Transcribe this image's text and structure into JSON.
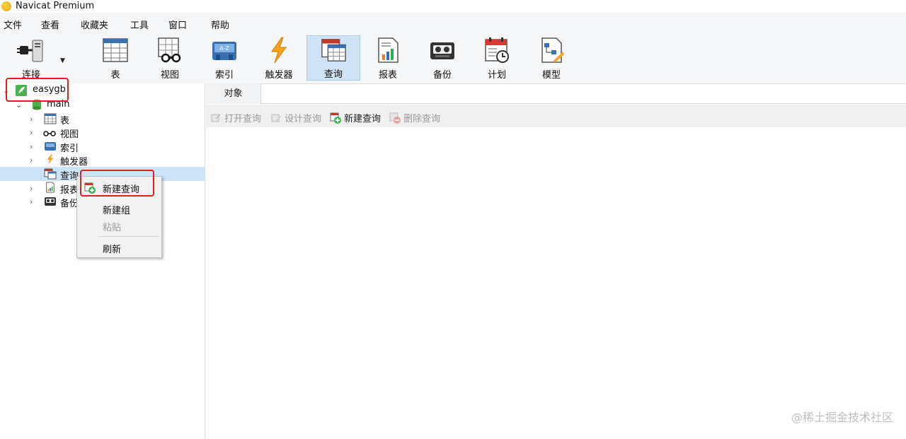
{
  "window": {
    "title": "Navicat Premium"
  },
  "menu": [
    "文件",
    "查看",
    "收藏夹",
    "工具",
    "窗口",
    "帮助"
  ],
  "toolbar": {
    "buttons": [
      {
        "label": "连接",
        "icon": "connection-plug-icon"
      },
      {
        "label": "表",
        "icon": "table-icon"
      },
      {
        "label": "视图",
        "icon": "view-glasses-icon"
      },
      {
        "label": "索引",
        "icon": "index-icon"
      },
      {
        "label": "触发器",
        "icon": "trigger-lightning-icon"
      },
      {
        "label": "查询",
        "icon": "query-icon"
      },
      {
        "label": "报表",
        "icon": "report-icon"
      },
      {
        "label": "备份",
        "icon": "backup-icon"
      },
      {
        "label": "计划",
        "icon": "schedule-calendar-icon"
      },
      {
        "label": "模型",
        "icon": "model-icon"
      }
    ],
    "active": "查询"
  },
  "tree": {
    "connection": "easygb",
    "schema": "main",
    "nodes": [
      "表",
      "视图",
      "索引",
      "触发器",
      "查询",
      "报表",
      "备份"
    ]
  },
  "object_tab": {
    "label": "对象"
  },
  "object_toolbar": {
    "open": "打开查询",
    "design": "设计查询",
    "new": "新建查询",
    "delete": "删除查询"
  },
  "context_menu": {
    "new_query": "新建查询",
    "new_group": "新建组",
    "paste": "粘贴",
    "refresh": "刷新"
  },
  "watermark": "@稀土掘金技术社区",
  "colors": {
    "active_toolbar": "#cfe3f7",
    "selected_row": "#cce4f7",
    "highlight": "#e02020"
  }
}
